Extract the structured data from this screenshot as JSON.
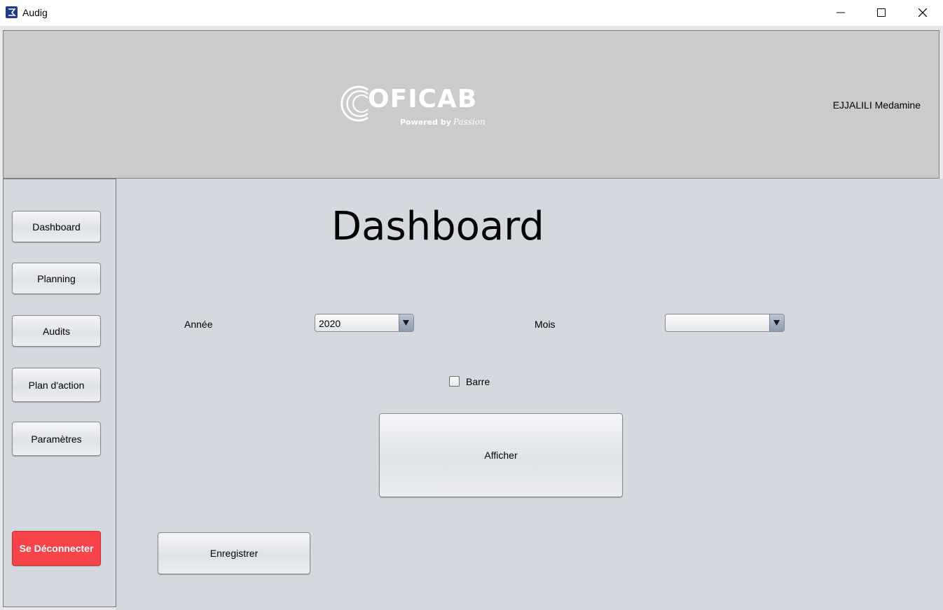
{
  "window": {
    "title": "Audig",
    "icon": "app-icon",
    "controls": [
      "minimize-icon",
      "maximize-icon",
      "close-icon"
    ]
  },
  "header": {
    "logo_text": "OFICAB",
    "logo_tagline": "Powered by",
    "logo_tagline_script": "Passion",
    "user_name": "EJJALILI Medamine"
  },
  "sidebar": {
    "items": [
      {
        "label": "Dashboard"
      },
      {
        "label": "Planning"
      },
      {
        "label": "Audits"
      },
      {
        "label": "Plan d'action"
      },
      {
        "label": "Paramètres"
      }
    ],
    "logout_label": "Se Déconnecter",
    "logout_color": "#f7444a"
  },
  "main": {
    "title": "Dashboard",
    "year_label": "Année",
    "year_value": "2020",
    "month_label": "Mois",
    "month_value": "",
    "checkbox_label": "Barre",
    "checkbox_checked": false,
    "show_button": "Afficher",
    "save_button": "Enregistrer"
  }
}
